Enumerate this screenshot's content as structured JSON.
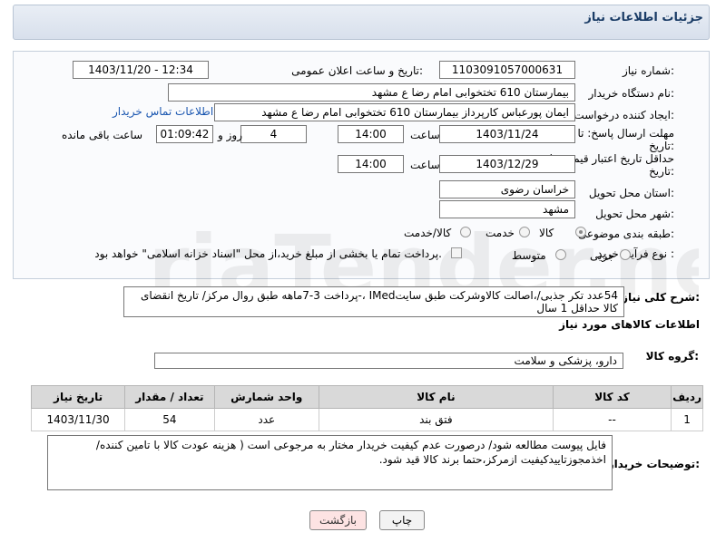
{
  "header": {
    "title": "جزئیات اطلاعات نیاز"
  },
  "fields": {
    "need_number_label": "شماره نیاز:",
    "need_number": "1103091057000631",
    "announce_label": "تاریخ و ساعت اعلان عمومی:",
    "announce_value": "1403/11/20 - 12:34",
    "buyer_org_label": "نام دستگاه خریدار:",
    "buyer_org": "بیمارستان 610 تختخوابی امام رضا ع  مشهد",
    "requester_label": "ایجاد کننده درخواست:",
    "requester": "ایمان پورعباس کارپرداز بیمارستان 610 تختخوابی امام رضا ع  مشهد",
    "contact_link": "اطلاعات تماس خریدار",
    "deadline_label_1": "مهلت ارسال پاسخ: تا",
    "deadline_label_2": "تاریخ:",
    "deadline_date": "1403/11/24",
    "time_label": "ساعت",
    "deadline_time": "14:00",
    "days": "4",
    "days_label": "روز و",
    "remaining": "01:09:42",
    "remaining_label": "ساعت باقی مانده",
    "validity_label_1": "حداقل تاریخ اعتبار قیمت: تا",
    "validity_label_2": "تاریخ:",
    "validity_date": "1403/12/29",
    "validity_time": "14:00",
    "province_label": "استان محل تحویل:",
    "province": "خراسان رضوی",
    "city_label": "شهر محل تحویل:",
    "city": "مشهد",
    "category_label": "طبقه بندی موضوعی:",
    "cat_goods": "کالا",
    "cat_service": "خدمت",
    "cat_both": "کالا/خدمت",
    "process_label": "نوع فرآیند خرید :",
    "proc_partial": "جزیی",
    "proc_medium": "متوسط",
    "payment_note": "پرداخت تمام یا بخشی از مبلغ خرید،از محل \"اسناد خزانه اسلامی\" خواهد بود."
  },
  "description": {
    "label": "شرح کلی نیاز:",
    "text": "54عدد تکر جذبی/،اصالت کالاوشرکت طبق سایتIMed ،-پرداخت 3-7ماهه طبق روال مرکز/ تاریخ انقضای کالا حداقل 1 سال"
  },
  "goods_info_title": "اطلاعات کالاهای مورد نیاز",
  "goods_group": {
    "label": "گروه کالا:",
    "value": "دارو، پزشکی و سلامت"
  },
  "table": {
    "headers": [
      "ردیف",
      "کد کالا",
      "نام کالا",
      "واحد شمارش",
      "تعداد / مقدار",
      "تاریخ نیاز"
    ],
    "rows": [
      {
        "row": "1",
        "code": "--",
        "name": "فتق بند",
        "unit": "عدد",
        "qty": "54",
        "date": "1403/11/30"
      }
    ]
  },
  "buyer_notes": {
    "label": "توضیحات خریدار:",
    "text": "فایل پیوست مطالعه شود/ درصورت عدم کیفیت خریدار مختار به مرجوعی است ( هزینه عودت کالا با تامین کننده/ اخذمجوزتاییدکیفیت ازمرکز،حتما برند کالا قید شود."
  },
  "buttons": {
    "print": "چاپ",
    "back": "بازگشت"
  },
  "watermark": "AriaTender.net",
  "colors": {
    "link": "#1a56b0",
    "title": "#1a3c66",
    "back_button_bg": "#fde3e3"
  }
}
